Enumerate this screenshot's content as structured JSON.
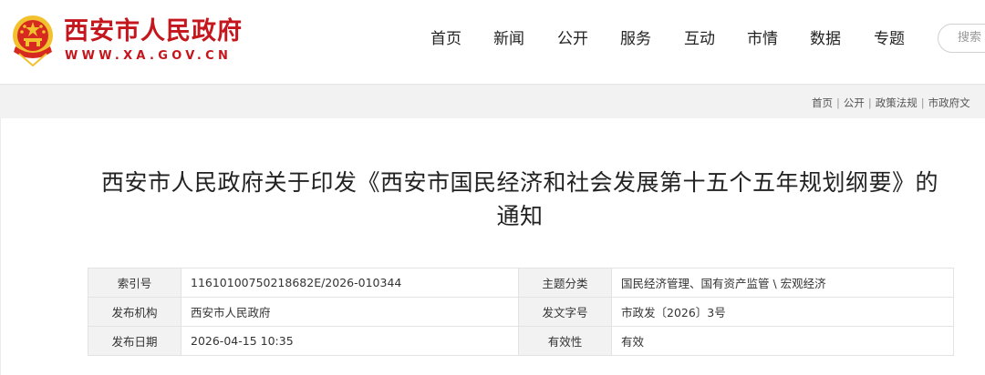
{
  "site": {
    "title": "西安市人民政府",
    "url_text": "WWW.XA.GOV.CN"
  },
  "nav": {
    "items": [
      {
        "label": "首页"
      },
      {
        "label": "新闻"
      },
      {
        "label": "公开"
      },
      {
        "label": "服务"
      },
      {
        "label": "互动"
      },
      {
        "label": "市情"
      },
      {
        "label": "数据"
      },
      {
        "label": "专题"
      }
    ],
    "search_placeholder": "搜索"
  },
  "breadcrumb": {
    "items": [
      "首页",
      "公开",
      "政策法规",
      "市政府文"
    ]
  },
  "document": {
    "title": "西安市人民政府关于印发《西安市国民经济和社会发展第十五个五年规划纲要》的通知"
  },
  "meta": {
    "index_no_label": "索引号",
    "index_no": "11610100750218682E/2026-010344",
    "category_label": "主题分类",
    "category": "国民经济管理、国有资产监管 \\ 宏观经济",
    "issuer_label": "发布机构",
    "issuer": "西安市人民政府",
    "doc_no_label": "发文字号",
    "doc_no": "市政发〔2026〕3号",
    "date_label": "发布日期",
    "date": "2026-04-15 10:35",
    "validity_label": "有效性",
    "validity": "有效"
  },
  "colors": {
    "brand_red": "#c4161c",
    "emblem_gold": "#f2c12e"
  },
  "icons": {
    "emblem": "national-emblem-icon"
  }
}
